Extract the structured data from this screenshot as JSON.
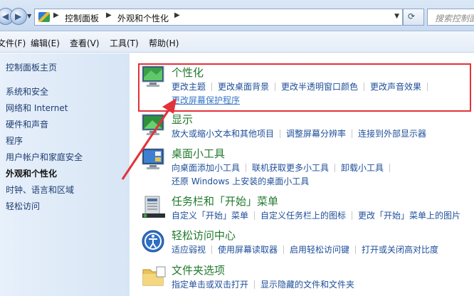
{
  "address": {
    "back": "back",
    "forward": "forward",
    "crumbs": [
      "控制面板",
      "外观和个性化"
    ],
    "search_placeholder": "搜索控制面"
  },
  "menu": [
    "文件(F)",
    "编辑(E)",
    "查看(V)",
    "工具(T)",
    "帮助(H)"
  ],
  "nav": {
    "home": "控制面板主页",
    "items": [
      "系统和安全",
      "网络和 Internet",
      "硬件和声音",
      "程序",
      "用户帐户和家庭安全",
      "外观和个性化",
      "时钟、语言和区域",
      "轻松访问"
    ],
    "current_index": 5
  },
  "categories": [
    {
      "title": "个性化",
      "links": [
        "更改主题",
        "更改桌面背景",
        "更改半透明窗口颜色",
        "更改声音效果"
      ],
      "links2": [
        "更改屏幕保护程序"
      ]
    },
    {
      "title": "显示",
      "links": [
        "放大或缩小文本和其他项目",
        "调整屏幕分辨率",
        "连接到外部显示器"
      ]
    },
    {
      "title": "桌面小工具",
      "links": [
        "向桌面添加小工具",
        "联机获取更多小工具",
        "卸载小工具"
      ],
      "links2": [
        "还原 Windows 上安装的桌面小工具"
      ]
    },
    {
      "title": "任务栏和「开始」菜单",
      "links": [
        "自定义「开始」菜单",
        "自定义任务栏上的图标",
        "更改「开始」菜单上的图片"
      ]
    },
    {
      "title": "轻松访问中心",
      "links": [
        "适应弱视",
        "使用屏幕读取器",
        "启用轻松访问键",
        "打开或关闭高对比度"
      ]
    },
    {
      "title": "文件夹选项",
      "links": [
        "指定单击或双击打开",
        "显示隐藏的文件和文件夹"
      ]
    }
  ],
  "colors": {
    "annotation_red": "#e3323a",
    "title_green": "#217a2d",
    "link_blue": "#1e4e9a"
  }
}
